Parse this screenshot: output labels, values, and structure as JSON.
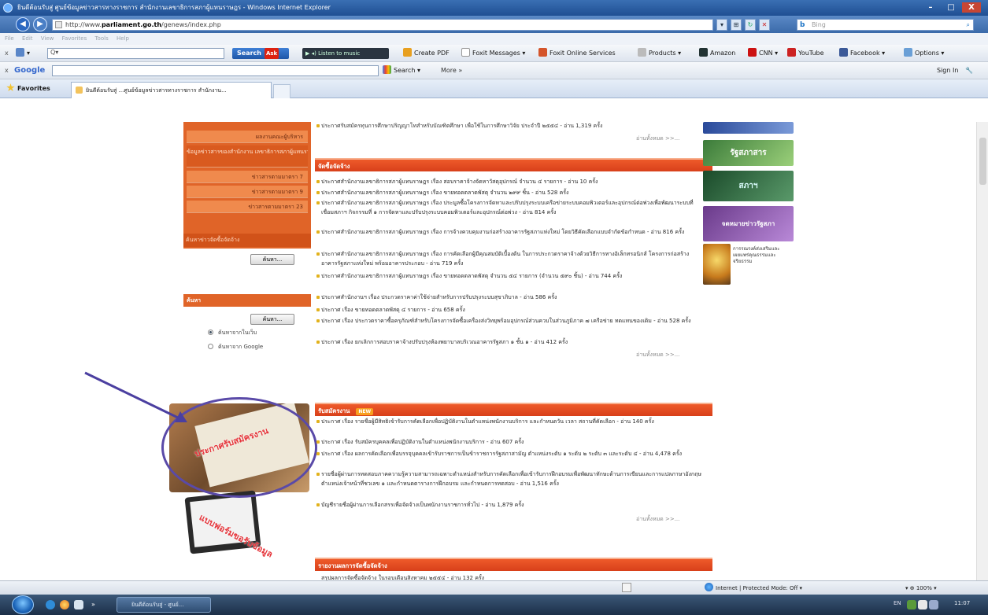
{
  "window": {
    "title": "ยินดีต้อนรับสู่ ศูนย์ข้อมูลข่าวสารทางราชการ สำนักงานเลขาธิการสภาผู้แทนราษฎร - Windows Internet Explorer",
    "minimize": "–",
    "maximize": "□",
    "close": "X"
  },
  "addressbar": {
    "url_prefix": "http://www.",
    "url_domain": "parliament.go.th",
    "url_path": "/genews/index.php",
    "search_engine": "Bing",
    "back_icon": "back-arrow-icon",
    "forward_icon": "forward-arrow-icon"
  },
  "menubar": {
    "items": [
      "File",
      "Edit",
      "View",
      "Favorites",
      "Tools",
      "Help"
    ]
  },
  "toolbar1": {
    "close": "x",
    "search_label": "Search",
    "ask_badge": "Ask",
    "radio_label": "Listen to music",
    "items": {
      "create_pdf": "Create PDF",
      "foxit_messages": "Foxit Messages",
      "foxit_online": "Foxit Online Services",
      "products": "Products",
      "amazon": "Amazon",
      "cnn": "CNN",
      "youtube": "YouTube",
      "facebook": "Facebook",
      "options": "Options"
    }
  },
  "toolbar2": {
    "close": "x",
    "google": "Google",
    "search": "Search",
    "more": "More »",
    "signin": "Sign In"
  },
  "favbar": {
    "favorites": "Favorites",
    "tab_title": "ยินดีต้อนรับสู่ ...ศูนย์ข้อมูลข่าวสารทางราชการ สำนักงาน..."
  },
  "sidebar": {
    "items": [
      "ผลงานคณะผู้บริหาร",
      "ข้อมูลข่าวสารของสำนักงาน เลขาธิการสภาผู้แทนราษฎร",
      "ข่าวสารตามมาตรา 7",
      "ข่าวสารตามมาตรา 9",
      "ข่าวสารตามมาตรา 23"
    ],
    "footer": "ค้นหาข่าวจัดซื้อจัดจ้าง",
    "search_button": "ค้นหา..."
  },
  "search_box": {
    "heading": "ค้นหา",
    "button": "ค้นหา...",
    "options": [
      "ค้นหาจากในเว็บ",
      "ค้นหาจาก Google"
    ],
    "selected": 0
  },
  "promo": {
    "image1_text": "ประกาศรับสมัครงาน",
    "image2_text": "แบบฟอร์มขอรับข้อมูล"
  },
  "main": {
    "top_item": "ประกาศรับสมัครทุนการศึกษาปริญญาโทสำหรับบัณฑิตศึกษา เพื่อใช้ในการศึกษาวิจัย ประจำปี ๒๕๕๔ - อ่าน 1,319 ครั้ง",
    "top_more": "อ่านทั้งหมด >>...",
    "procurement": {
      "heading": "จัดซื้อจัดจ้าง",
      "items": [
        "ประกาศสำนักงานเลขาธิการสภาผู้แทนราษฎร เรื่อง สอบราคาจ้างจัดหาวัสดุอุปกรณ์ จำนวน ๔ รายการ - อ่าน 10 ครั้ง",
        "ประกาศสำนักงานเลขาธิการสภาผู้แทนราษฎร เรื่อง ขายทอดตลาดพัสดุ จำนวน ๒๙๙ ชิ้น - อ่าน 528 ครั้ง",
        "ประกาศสำนักงานเลขาธิการสภาผู้แทนราษฎร เรื่อง ประมูลซื้อโครงการจัดหาและปรับปรุงระบบเครือข่ายระบบคอมพิวเตอร์และอุปกรณ์ต่อพ่วงเพื่อพัฒนาระบบที่เชื่อมสภาฯ กิจกรรมที่ ๑ การจัดหาและปรับปรุงระบบคอมพิวเตอร์และอุปกรณ์ต่อพ่วง - อ่าน 814 ครั้ง",
        "ประกาศสำนักงานเลขาธิการสภาผู้แทนราษฎร เรื่อง การจ้างควบคุมงานก่อสร้างอาคารรัฐสภาแห่งใหม่ โดยวิธีคัดเลือกแบบจำกัดข้อกำหนด - อ่าน 816 ครั้ง",
        "ประกาศสำนักงานเลขาธิการสภาผู้แทนราษฎร เรื่อง การคัดเลือกผู้มีคุณสมบัติเบื้องต้น ในการประกวดราคาจ้างด้วยวิธีการทางอิเล็กทรอนิกส์ โครงการก่อสร้างอาคารรัฐสภาแห่งใหม่ พร้อมอาคารประกอบ - อ่าน 719 ครั้ง",
        "ประกาศสำนักงานเลขาธิการสภาผู้แทนราษฎร เรื่อง ขายทอดตลาดพัสดุ จำนวน ๕๔ รายการ (จำนวน ๕๙๐ ชิ้น) - อ่าน 744 ครั้ง",
        "ประกาศสำนักงานฯ เรื่อง ประกวดราคาค่าใช้จ่ายสำหรับการปรับปรุงระบบสุขาภิบาล - อ่าน 586 ครั้ง",
        "ประกาศ เรื่อง ขายทอดตลาดพัสดุ ๔ รายการ - อ่าน 658 ครั้ง",
        "ประกาศ เรื่อง ประกวดราคาซื้อครุภัณฑ์สำหรับโครงการจัดซื้อเครื่องส่งวิทยุพร้อมอุปกรณ์ส่วนควบในส่วนภูมิภาค ๗ เครือข่าย ทดแทนของเดิม - อ่าน 528 ครั้ง",
        "ประกาศ เรื่อง ยกเลิกการสอบราคาจ้างปรับปรุงห้องพยาบาลบริเวณอาคารรัฐสภา ๑ ชั้น ๑ - อ่าน 412 ครั้ง"
      ],
      "more": "อ่านทั้งหมด >>..."
    },
    "jobs": {
      "heading": "รับสมัครงาน",
      "badge": "NEW",
      "items": [
        "ประกาศ เรื่อง รายชื่อผู้มีสิทธิเข้ารับการคัดเลือกเพื่อปฏิบัติงานในตำแหน่งพนักงานบริการ และกำหนดวัน เวลา สถานที่คัดเลือก - อ่าน 140 ครั้ง",
        "ประกาศ เรื่อง รับสมัครบุคคลเพื่อปฏิบัติงานในตำแหน่งพนักงานบริการ - อ่าน 607 ครั้ง",
        "ประกาศ เรื่อง ผลการคัดเลือกเพื่อบรรจุบุคคลเข้ารับราชการเป็นข้าราชการรัฐสภาสามัญ ตำแหน่งระดับ ๑ ระดับ ๒ ระดับ ๓ และระดับ ๔ - อ่าน 4,478 ครั้ง",
        "รายชื่อผู้ผ่านการทดสอบภาคความรู้ความสามารถเฉพาะตำแหน่งสำหรับการคัดเลือกเพื่อเข้ารับการฝึกอบรมเพื่อพัฒนาทักษะด้านการเขียนและการแปลภาษาอังกฤษ ตำแหน่งเจ้าหน้าที่ชวเลข ๑ และกำหนดตารางการฝึกอบรม และกำหนดการทดสอบ - อ่าน 1,516 ครั้ง",
        "บัญชีรายชื่อผู้ผ่านการเลือกสรรเพื่อจัดจ้างเป็นพนักงานราชการทั่วไป - อ่าน 1,879 ครั้ง"
      ],
      "more": "อ่านทั้งหมด >>..."
    },
    "report": {
      "heading": "รายงานผลการจัดซื้อจัดจ้าง",
      "first_item": "สรุปผลการจัดซื้อจัดจ้าง ในรอบเดือนสิงหาคม ๒๕๕๔ - อ่าน 132 ครั้ง"
    }
  },
  "right_column": {
    "tile1": "รัฐสภาสาร",
    "tile2": "สภาฯ",
    "tile3": "จดหมายข่าวรัฐสภา",
    "caption": "การรณรงค์ส่งเสริมและเผยแพร่คุณธรรมและจริยธรรม"
  },
  "statusbar": {
    "zone": "Internet | Protected Mode: Off",
    "zoom": "100%"
  },
  "taskbar": {
    "task_label": "ยินดีต้อนรับสู่ - ศูนย์...",
    "lang": "EN",
    "clock": "11:07"
  },
  "colors": {
    "accent_orange": "#e06428",
    "header_red": "#d8401a",
    "annotation_purple": "#5a4aa8"
  }
}
